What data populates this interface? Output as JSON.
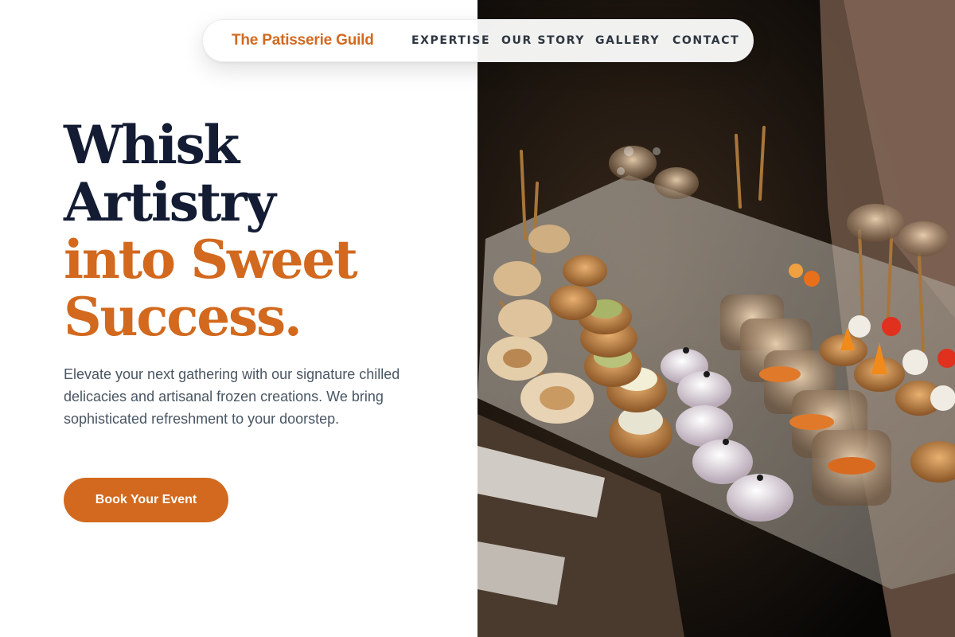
{
  "nav": {
    "brand": "The Patisserie Guild",
    "links": [
      "EXPERTISE",
      "OUR STORY",
      "GALLERY",
      "CONTACT"
    ]
  },
  "hero": {
    "headline_lines": [
      "Whisk",
      "Artistry",
      "into Sweet",
      "Success."
    ],
    "description": "Elevate your next gathering with our signature chilled delicacies and artisanal frozen creations. We bring sophisticated refreshment to your doorstep.",
    "cta_label": "Book Your Event"
  },
  "colors": {
    "accent": "#d2691e",
    "headline_dark": "#131c33",
    "body_text": "#4a5663",
    "nav_text": "#2d3640"
  },
  "image": {
    "subject": "catering tray with canapés, tartlets and verrines"
  }
}
